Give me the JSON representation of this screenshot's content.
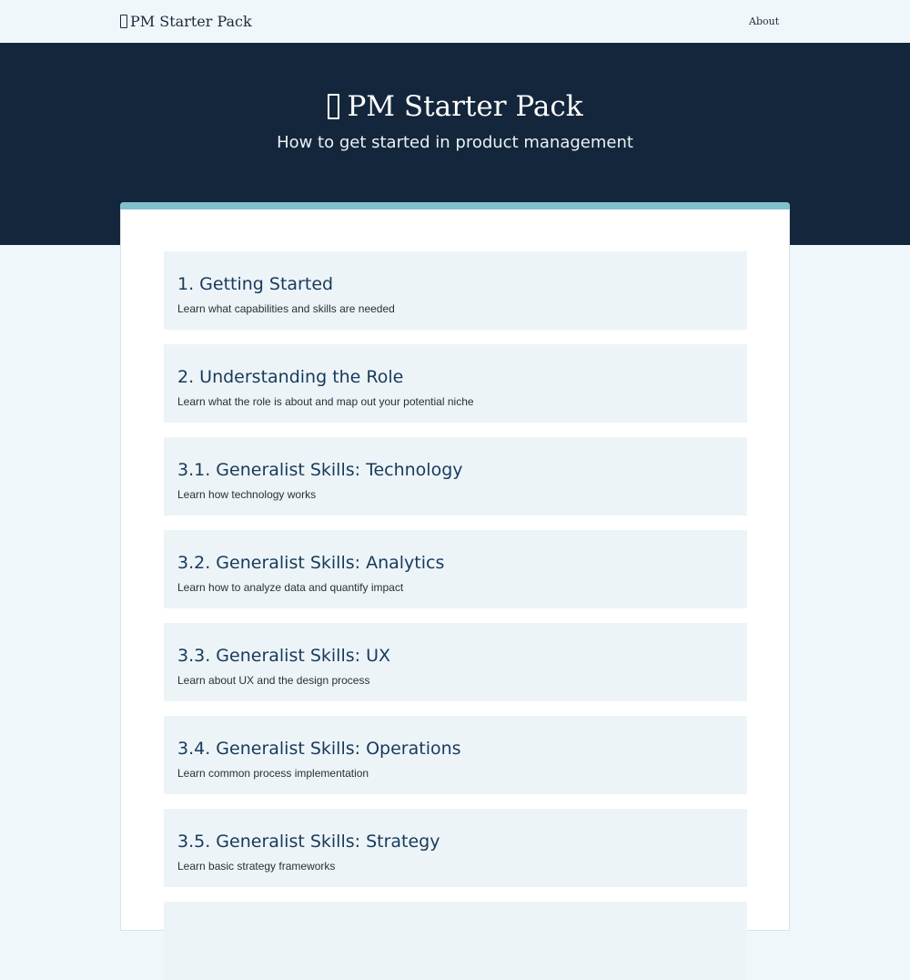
{
  "nav": {
    "brand_icon": "box-glyph-icon",
    "brand_label": "PM Starter Pack",
    "about_label": "About"
  },
  "hero": {
    "title_icon": "box-glyph-icon",
    "title": "PM Starter Pack",
    "subtitle": "How to get started in product management"
  },
  "colors": {
    "header_bg": "#13263b",
    "page_bg": "#f0f7fa",
    "card_accent": "#82c0cd",
    "item_bg": "#edf4f7",
    "item_title": "#173a5c"
  },
  "lessons": [
    {
      "title": "1. Getting Started",
      "desc": "Learn what capabilities and skills are needed"
    },
    {
      "title": "2. Understanding the Role",
      "desc": "Learn what the role is about and map out your potential niche"
    },
    {
      "title": "3.1. Generalist Skills: Technology",
      "desc": "Learn how technology works"
    },
    {
      "title": "3.2. Generalist Skills: Analytics",
      "desc": "Learn how to analyze data and quantify impact"
    },
    {
      "title": "3.3. Generalist Skills: UX",
      "desc": "Learn about UX and the design process"
    },
    {
      "title": "3.4. Generalist Skills: Operations",
      "desc": "Learn common process implementation"
    },
    {
      "title": "3.5. Generalist Skills: Strategy",
      "desc": "Learn basic strategy frameworks"
    }
  ]
}
